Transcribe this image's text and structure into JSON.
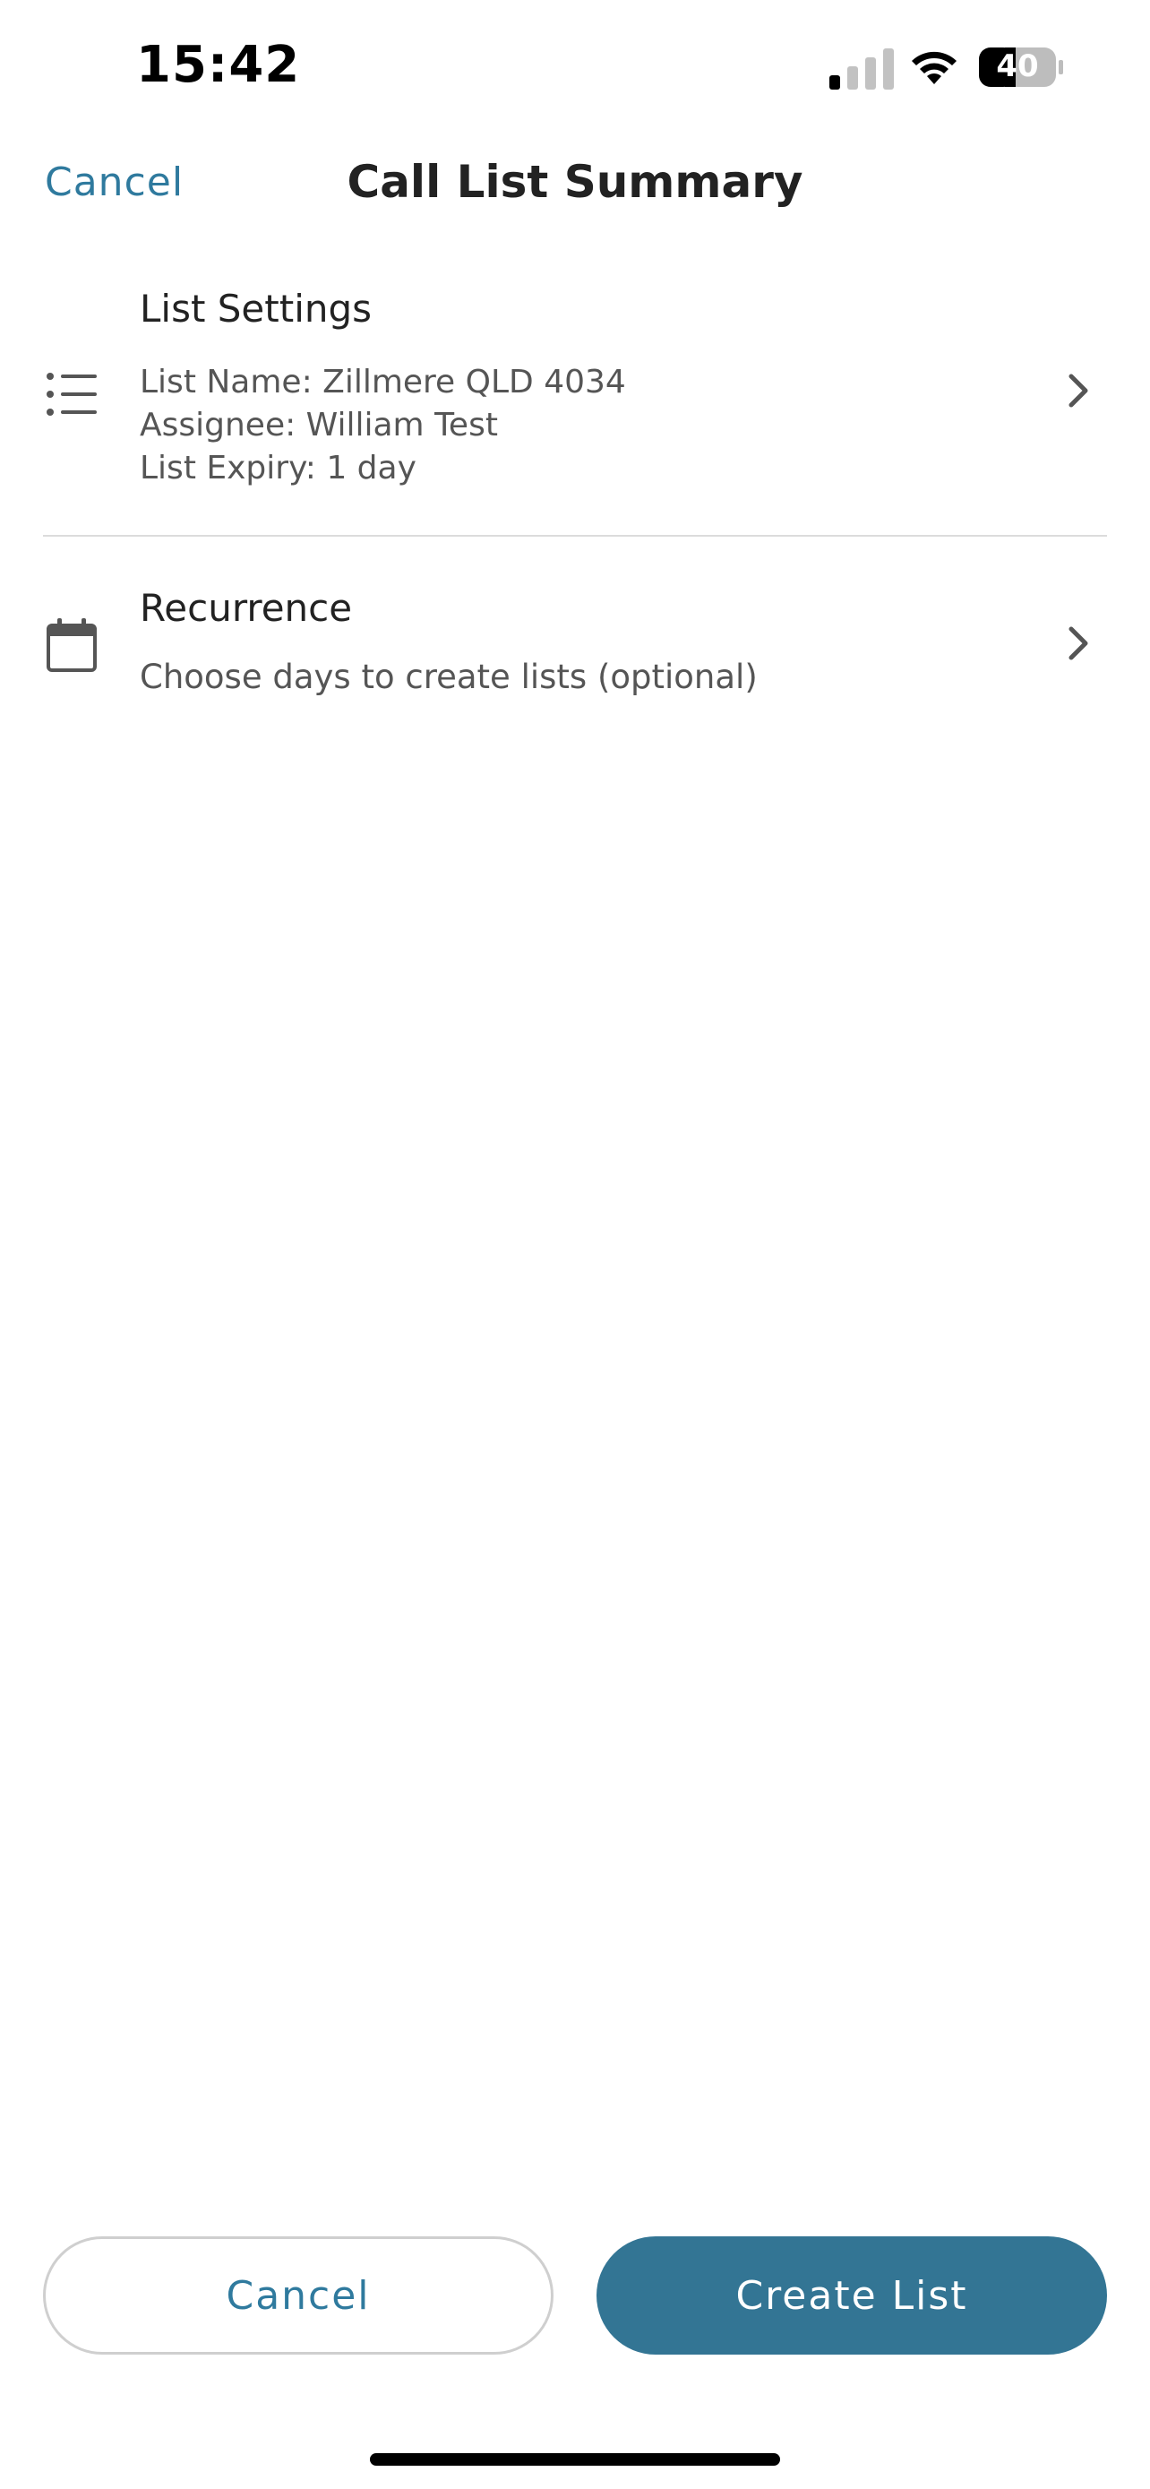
{
  "status_bar": {
    "time": "15:42",
    "battery_level": "40"
  },
  "header": {
    "cancel_label": "Cancel",
    "title": "Call List Summary"
  },
  "list_settings": {
    "title": "List Settings",
    "list_name": "List Name: Zillmere QLD 4034",
    "assignee": "Assignee: William Test",
    "expiry": "List Expiry: 1 day",
    "icon": "list-icon"
  },
  "recurrence": {
    "title": "Recurrence",
    "subtitle": "Choose days to create lists (optional)",
    "icon": "calendar-icon"
  },
  "footer": {
    "cancel_label": "Cancel",
    "create_label": "Create List"
  },
  "colors": {
    "accent": "#2f7a9e",
    "primary_button": "#337594"
  }
}
